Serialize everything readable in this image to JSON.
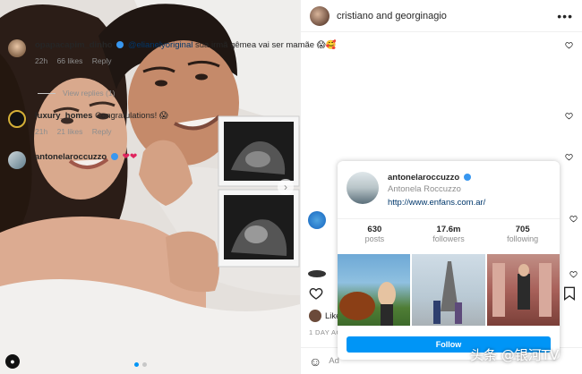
{
  "post": {
    "authors": "cristiano and georginagio",
    "more_label": "•••"
  },
  "comments": [
    {
      "user": "opapacapim_dinho",
      "mention": "@elianelyoriginal",
      "text": "sua irmã gêmea vai ser mamãe 😱🥰",
      "time": "22h",
      "likes": "66 likes",
      "reply": "Reply"
    },
    {
      "user": "luxury_homes",
      "text": "Congratulations! 😱",
      "time": "21h",
      "likes": "21 likes",
      "reply": "Reply"
    },
    {
      "user": "antonelaroccuzzo",
      "text": "❤❤"
    }
  ],
  "view_replies": "View replies (1)",
  "hovercard": {
    "username": "antonelaroccuzzo",
    "name": "Antonela Roccuzzo",
    "link": "http://www.enfans.com.ar/",
    "stats": [
      {
        "value": "630",
        "label": "posts"
      },
      {
        "value": "17.6m",
        "label": "followers"
      },
      {
        "value": "705",
        "label": "following"
      }
    ],
    "follow_label": "Follow"
  },
  "likes_prefix": "Like",
  "date": "1 DAY AG",
  "add_comment_placeholder": "Ad",
  "watermark": "头条 @银河TV",
  "colors": {
    "accent": "#0095f6",
    "heart": "#e0245e",
    "verified": "#3897f0"
  }
}
